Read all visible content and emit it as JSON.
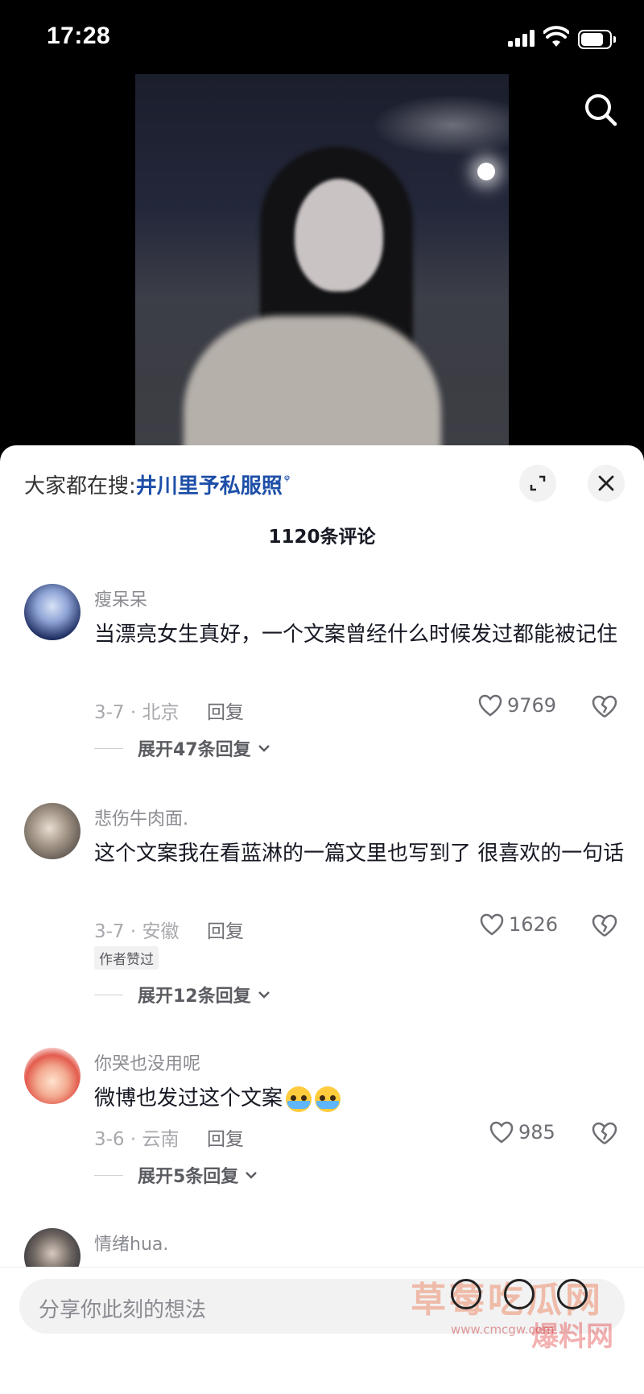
{
  "status_bar": {
    "time": "17:28",
    "battery_level": 0.8
  },
  "hot_search": {
    "prefix": "大家都在搜:",
    "keyword": "井川里予私服照"
  },
  "comment_count": "1120条评论",
  "comments": [
    {
      "username": "瘦呆呆",
      "text": "当漂亮女生真好，一个文案曾经什么时候发过都能被记住",
      "date_loc": "3-7 · 北京",
      "reply": "回复",
      "likes": "9769",
      "expand": "展开47条回复",
      "avatar_color": "#3b4a8c"
    },
    {
      "username": "悲伤牛肉面.",
      "text": "这个文案我在看蓝淋的一篇文里也写到了 很喜欢的一句话",
      "date_loc": "3-7 · 安徽",
      "reply": "回复",
      "likes": "1626",
      "badge": "作者赞过",
      "expand": "展开12条回复",
      "avatar_color": "#9a8f86"
    },
    {
      "username": "你哭也没用呢",
      "text": "微博也发过这个文案",
      "date_loc": "3-6 · 云南",
      "reply": "回复",
      "likes": "985",
      "expand": "展开5条回复",
      "avatar_color": "#e86b5a"
    },
    {
      "username": "情绪hua.",
      "avatar_color": "#4b4f60"
    }
  ],
  "input": {
    "placeholder": "分享你此刻的想法"
  },
  "watermark": {
    "main": "草莓吃瓜网",
    "url": "www.cmcgw.com",
    "sub": "爆料网"
  },
  "icons": {
    "search": "search-icon",
    "expand": "fullscreen-icon",
    "close": "close-icon",
    "like": "heart-icon",
    "dislike": "broken-heart-icon",
    "chevron": "chevron-down-icon"
  },
  "colors": {
    "keyword": "#1d4fa8",
    "meta": "#a8a9ad",
    "text": "#161823"
  }
}
